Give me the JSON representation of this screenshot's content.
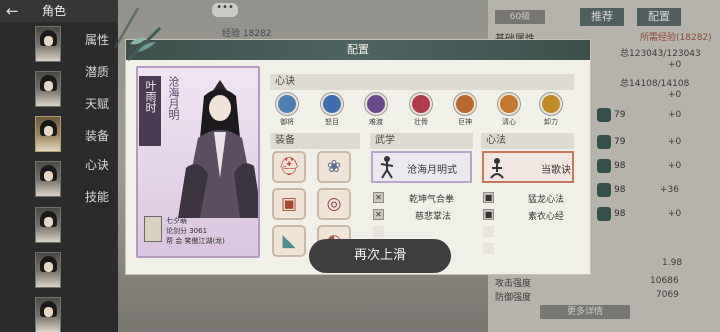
{
  "left_nav": {
    "back_icon": "arrow-left-icon",
    "title": "角色",
    "tabs": [
      "属性",
      "潜质",
      "天赋",
      "装备",
      "心诀",
      "技能"
    ]
  },
  "background": {
    "chat_bubble": "•••",
    "xp_text": "经验 18282",
    "level_badge": "60级",
    "recommend_button": "推荐",
    "config_button": "配置",
    "stats_tab": "基础属性",
    "stats_link": "所需经验(18282)",
    "hp_value": "总123043/123043",
    "plus_zero_1": "+0",
    "mp_value": "总14108/14108",
    "plus_zero_2": "+0",
    "gem_values": [
      "79",
      "79",
      "98",
      "98",
      "98"
    ],
    "gem_bonus": [
      "+0",
      "+0",
      "+0",
      "+36",
      "+0"
    ],
    "value_1": "1.98",
    "attack_label": "攻击强度",
    "attack_value": "10686",
    "defense_label": "防御强度",
    "defense_value": "7069",
    "more_details": "更多详情"
  },
  "modal": {
    "title": "配置",
    "character": {
      "name": "叶雨时",
      "title_text": "沧海月明",
      "nickname": "七夕萌",
      "score": "论剑分 3061",
      "faction": "帮  会  笑傲江湖(龙)"
    },
    "sections": {
      "xinjue": "心诀",
      "equipment": "装备",
      "wuxue": "武学",
      "xinfa": "心法"
    },
    "skills": [
      {
        "label": "御将",
        "color": "#4c7fb8",
        "icon": "wave-icon"
      },
      {
        "label": "怒目",
        "color": "#3d6fb0",
        "icon": "eye-icon"
      },
      {
        "label": "难渡",
        "color": "#6b4a92",
        "icon": "wing-icon"
      },
      {
        "label": "壮骨",
        "color": "#b03a4e",
        "icon": "flower-icon"
      },
      {
        "label": "巨神",
        "color": "#b76a2c",
        "icon": "sun-icon"
      },
      {
        "label": "清心",
        "color": "#c4782e",
        "icon": "flower-icon"
      },
      {
        "label": "卸力",
        "color": "#c38a2a",
        "icon": "swirl-icon"
      }
    ],
    "equipment": [
      {
        "icon": "helmet-icon",
        "color": "#b7412f"
      },
      {
        "icon": "necklace-icon",
        "color": "#5c6f8e"
      },
      {
        "icon": "armor-icon",
        "color": "#a5462f"
      },
      {
        "icon": "ring-icon",
        "color": "#8a3f52"
      },
      {
        "icon": "boots-icon",
        "color": "#4f8f8a"
      },
      {
        "icon": "bracer-icon",
        "color": "#9b5b4b"
      }
    ],
    "wuxue_main": "沧海月明式",
    "wuxue_list": [
      "乾坤气合拳",
      "慈悲掌法"
    ],
    "xinfa_main": "当歌诀",
    "xinfa_list": [
      "猛龙心法",
      "素衣心经"
    ]
  },
  "toast": "再次上滑",
  "colors": {
    "header": "#3c4f4b",
    "card_border": "#b59ac2",
    "xinfa_border": "#c9785a",
    "wuxue_border": "#9e86b4"
  }
}
